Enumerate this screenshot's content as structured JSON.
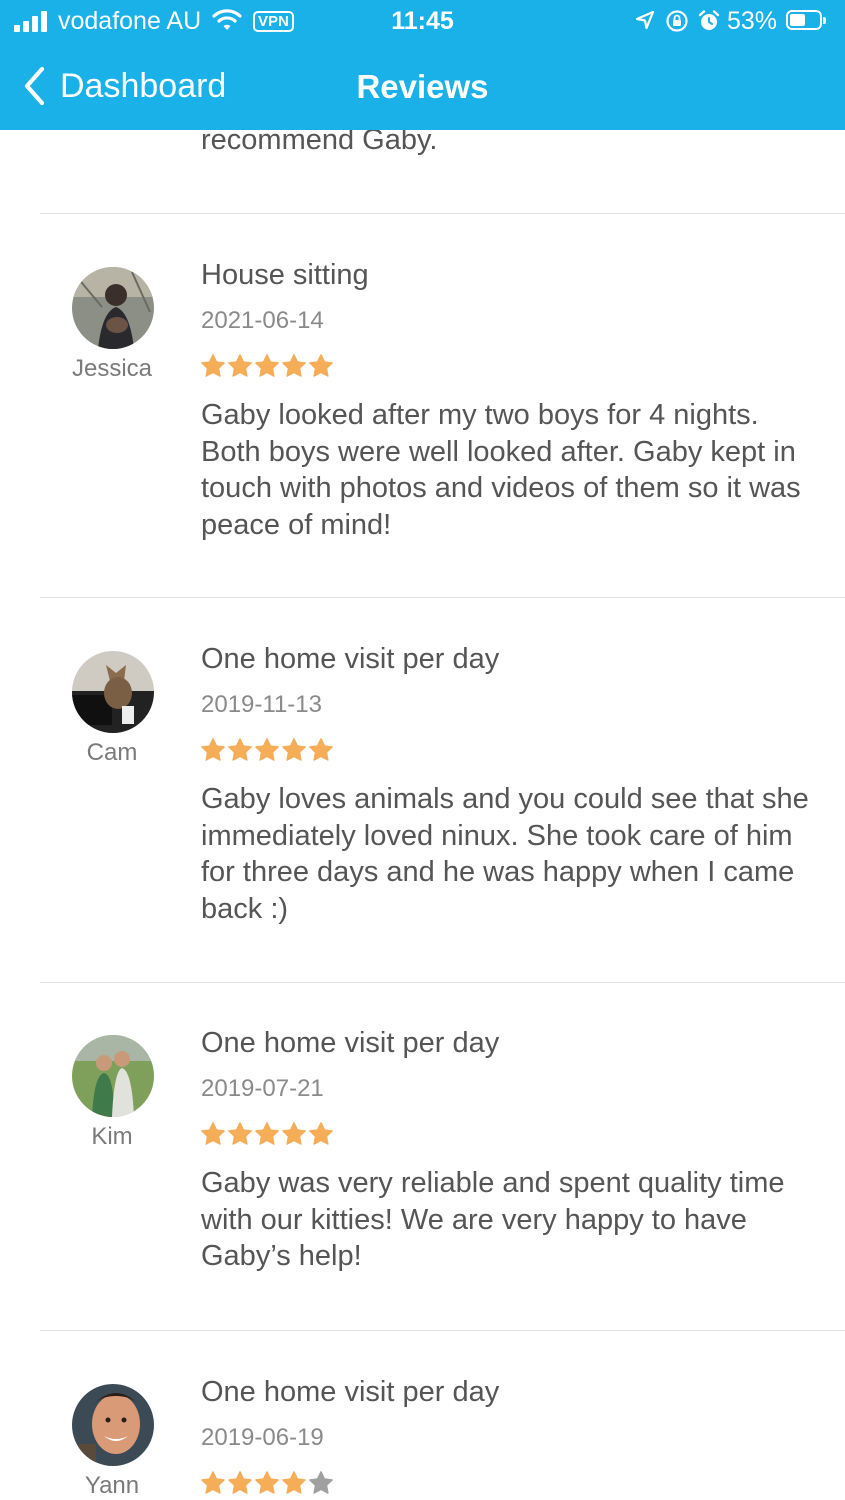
{
  "status_bar": {
    "carrier": "vodafone AU",
    "vpn": "VPN",
    "time": "11:45",
    "battery_percent": "53%"
  },
  "nav": {
    "back_label": "Dashboard",
    "title": "Reviews"
  },
  "partial_review_text": "recommend Gaby.",
  "reviews": [
    {
      "reviewer": "Jessica",
      "service": "House sitting",
      "date": "2021-06-14",
      "rating": 5,
      "text": "Gaby looked after my two boys for 4 nights. Both boys were well looked after. Gaby kept in touch with photos and videos of them so it was peace of mind!"
    },
    {
      "reviewer": "Cam",
      "service": "One home visit per day",
      "date": "2019-11-13",
      "rating": 5,
      "text": "Gaby loves animals and you could see that she immediately loved ninux. She took care of him for three days and he was happy when I came back :)"
    },
    {
      "reviewer": "Kim",
      "service": "One home visit per day",
      "date": "2019-07-21",
      "rating": 5,
      "text": "Gaby was very reliable and spent quality time with our kitties! We are very happy to have Gaby’s help!"
    },
    {
      "reviewer": "Yann",
      "service": "One home visit per day",
      "date": "2019-06-19",
      "rating": 4,
      "text": ""
    }
  ],
  "colors": {
    "header_bg": "#1ab0e8",
    "star_filled": "#f6ad58",
    "star_empty": "#a0a0a0"
  }
}
